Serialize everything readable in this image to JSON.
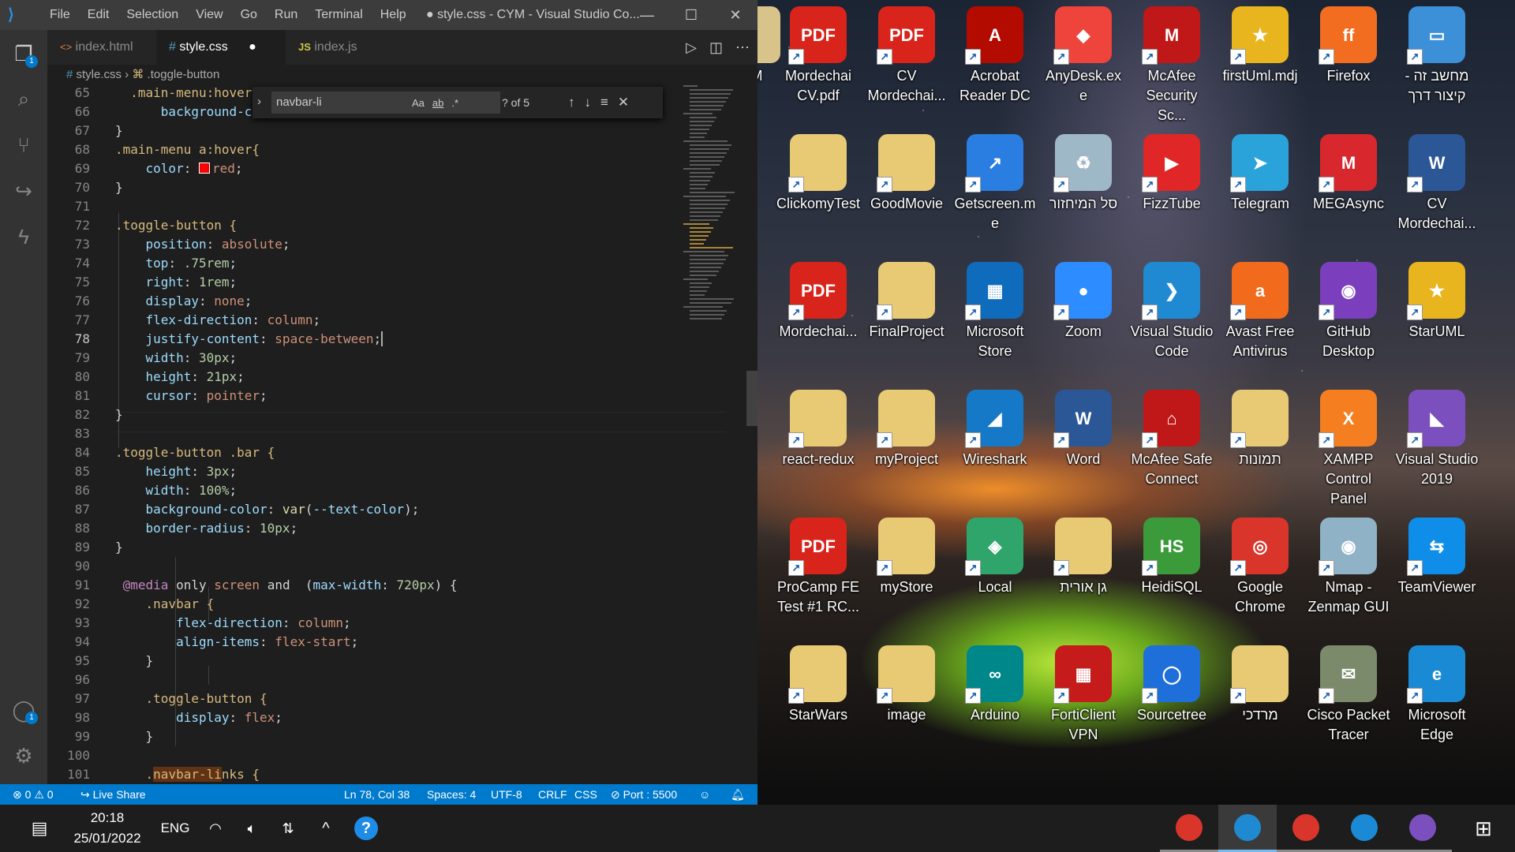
{
  "vscode": {
    "menu": [
      "File",
      "Edit",
      "Selection",
      "View",
      "Go",
      "Run",
      "Terminal",
      "Help"
    ],
    "window_title": "● style.css - CYM - Visual Studio Co...",
    "tabs": [
      {
        "icon": "<>",
        "label": "index.html"
      },
      {
        "icon": "#",
        "label": "style.css",
        "modified": "●"
      },
      {
        "icon": "JS",
        "label": "index.js"
      }
    ],
    "breadcrumb": {
      "file": "style.css",
      "symbol": ".toggle-button"
    },
    "find": {
      "query": "navbar-li",
      "count": "? of 5",
      "opt_case": "Aa",
      "opt_word": "ab",
      "opt_regex": ".*"
    },
    "activity_badges": {
      "explorer": "1",
      "accounts": "1"
    },
    "line_numbers": [
      "65",
      "66",
      "67",
      "68",
      "69",
      "70",
      "71",
      "72",
      "73",
      "74",
      "75",
      "76",
      "77",
      "78",
      "79",
      "80",
      "81",
      "82",
      "83",
      "84",
      "85",
      "86",
      "87",
      "88",
      "89",
      "90",
      "91",
      "92",
      "93",
      "94",
      "95",
      "96",
      "97",
      "98",
      "99",
      "100",
      "101"
    ],
    "current_line": "78",
    "code_text": {
      "l65a": ".main-menu:hover",
      "l66a": "background-c",
      "l67": "}",
      "l68": ".main-menu a:hover{",
      "l69p": "color",
      "l69v": "red",
      "l70": "}",
      "l72": ".toggle-button {",
      "l73p": "position",
      "l73v": "absolute",
      "l74p": "top",
      "l74v": ".75rem",
      "l75p": "right",
      "l75v": "1rem",
      "l76p": "display",
      "l76v": "none",
      "l77p": "flex-direction",
      "l77v": "column",
      "l78p": "justify-content",
      "l78v": "space-between",
      "l79p": "width",
      "l79v": "30px",
      "l80p": "height",
      "l80v": "21px",
      "l81p": "cursor",
      "l81v": "pointer",
      "l82": "}",
      "l84": ".toggle-button .bar {",
      "l85p": "height",
      "l85v": "3px",
      "l86p": "width",
      "l86v": "100%",
      "l87p": "background-color",
      "l87f": "var",
      "l87v": "--text-color",
      "l88p": "border-radius",
      "l88v": "10px",
      "l89": "}",
      "l91kw": "@media",
      "l91a": "only",
      "l91b": "screen",
      "l91c": "and",
      "l91p": "max-width",
      "l91v": "720px",
      "l92": ".navbar {",
      "l93p": "flex-direction",
      "l93v": "column",
      "l94p": "align-items",
      "l94v": "flex-start",
      "l95": "}",
      "l97": ".toggle-button {",
      "l98p": "display",
      "l98v": "flex",
      "l99": "}",
      "l101a": ".",
      "l101b": "navbar-li",
      "l101c": "nks {"
    },
    "status": {
      "errors": "0",
      "warnings": "0",
      "live_share": "Live Share",
      "position": "Ln 78, Col 38",
      "spaces": "Spaces: 4",
      "encoding": "UTF-8",
      "eol": "CRLF",
      "language": "CSS",
      "port": "Port : 5500"
    }
  },
  "desktop": {
    "icons": [
      {
        "label": "YM",
        "color": "#d8c48a",
        "glyph": ""
      },
      {
        "label": "Mordechai CV.pdf",
        "color": "#d9241b",
        "glyph": "PDF"
      },
      {
        "label": "CV Mordechai...",
        "color": "#d9241b",
        "glyph": "PDF"
      },
      {
        "label": "Acrobat Reader DC",
        "color": "#b30b00",
        "glyph": "A"
      },
      {
        "label": "AnyDesk.exe",
        "color": "#ef443b",
        "glyph": "◆"
      },
      {
        "label": "McAfee Security Sc...",
        "color": "#c01818",
        "glyph": "M"
      },
      {
        "label": "firstUml.mdj",
        "color": "#e9b51f",
        "glyph": "★"
      },
      {
        "label": "Firefox",
        "color": "#f36d21",
        "glyph": "ff"
      },
      {
        "label": "מחשב זה - קיצור דרך",
        "color": "#3c90d8",
        "glyph": "▭"
      },
      {
        "label": "ClickomyTest",
        "color": "#e8c974",
        "glyph": ""
      },
      {
        "label": "GoodMovie",
        "color": "#e8c974",
        "glyph": ""
      },
      {
        "label": "Getscreen.me",
        "color": "#2a7de1",
        "glyph": "↗"
      },
      {
        "label": "סל המיחזור",
        "color": "#9fb8c8",
        "glyph": "♻"
      },
      {
        "label": "FizzTube",
        "color": "#e02626",
        "glyph": "▶"
      },
      {
        "label": "Telegram",
        "color": "#2aa3db",
        "glyph": "➤"
      },
      {
        "label": "MEGAsync",
        "color": "#d9272e",
        "glyph": "M"
      },
      {
        "label": "CV Mordechai...",
        "color": "#2b5797",
        "glyph": "W"
      },
      {
        "label": "Mordechai...",
        "color": "#d9241b",
        "glyph": "PDF"
      },
      {
        "label": "FinalProject",
        "color": "#e8c974",
        "glyph": ""
      },
      {
        "label": "Microsoft Store",
        "color": "#0f6cbd",
        "glyph": "▦"
      },
      {
        "label": "Zoom",
        "color": "#2d8cff",
        "glyph": "●"
      },
      {
        "label": "Visual Studio Code",
        "color": "#1f8ad2",
        "glyph": "❯"
      },
      {
        "label": "Avast Free Antivirus",
        "color": "#f26b1d",
        "glyph": "a"
      },
      {
        "label": "GitHub Desktop",
        "color": "#7b3fbd",
        "glyph": "◉"
      },
      {
        "label": "StarUML",
        "color": "#e9b51f",
        "glyph": "★"
      },
      {
        "label": "react-redux",
        "color": "#e8c974",
        "glyph": ""
      },
      {
        "label": "myProject",
        "color": "#e8c974",
        "glyph": ""
      },
      {
        "label": "Wireshark",
        "color": "#1679c7",
        "glyph": "◢"
      },
      {
        "label": "Word",
        "color": "#2b5797",
        "glyph": "W"
      },
      {
        "label": "McAfee Safe Connect",
        "color": "#c01818",
        "glyph": "⌂"
      },
      {
        "label": "תמונות",
        "color": "#e8c974",
        "glyph": ""
      },
      {
        "label": "XAMPP Control Panel",
        "color": "#f57f20",
        "glyph": "X"
      },
      {
        "label": "Visual Studio 2019",
        "color": "#7c4fbf",
        "glyph": "◣"
      },
      {
        "label": "ProCamp FE Test #1 RC...",
        "color": "#d9241b",
        "glyph": "PDF"
      },
      {
        "label": "myStore",
        "color": "#e8c974",
        "glyph": ""
      },
      {
        "label": "Local",
        "color": "#2fa56c",
        "glyph": "◈"
      },
      {
        "label": "גן אורית",
        "color": "#e8c974",
        "glyph": ""
      },
      {
        "label": "HeidiSQL",
        "color": "#3b9b3b",
        "glyph": "HS"
      },
      {
        "label": "Google Chrome",
        "color": "#d9352b",
        "glyph": "◎"
      },
      {
        "label": "Nmap - Zenmap GUI",
        "color": "#8fb2c7",
        "glyph": "◉"
      },
      {
        "label": "TeamViewer",
        "color": "#0e8ee9",
        "glyph": "⇆"
      },
      {
        "label": "StarWars",
        "color": "#e8c974",
        "glyph": ""
      },
      {
        "label": "image",
        "color": "#e8c974",
        "glyph": ""
      },
      {
        "label": "Arduino",
        "color": "#00878a",
        "glyph": "∞"
      },
      {
        "label": "FortiClient VPN",
        "color": "#c51b1b",
        "glyph": "▦"
      },
      {
        "label": "Sourcetree",
        "color": "#1e6fd9",
        "glyph": "◯"
      },
      {
        "label": "מרדכי",
        "color": "#e8c974",
        "glyph": ""
      },
      {
        "label": "Cisco Packet Tracer",
        "color": "#7a8a6a",
        "glyph": "✉"
      },
      {
        "label": "Microsoft Edge",
        "color": "#1a8ad4",
        "glyph": "e"
      }
    ]
  },
  "taskbar": {
    "time": "20:18",
    "date": "25/01/2022",
    "language": "ENG",
    "apps": [
      {
        "name": "chrome-profile",
        "color": "#d9352b"
      },
      {
        "name": "vscode",
        "color": "#1f8ad2"
      },
      {
        "name": "chrome",
        "color": "#d9352b"
      },
      {
        "name": "edge",
        "color": "#1a8ad4"
      },
      {
        "name": "visual-studio",
        "color": "#7c4fbf"
      }
    ]
  }
}
